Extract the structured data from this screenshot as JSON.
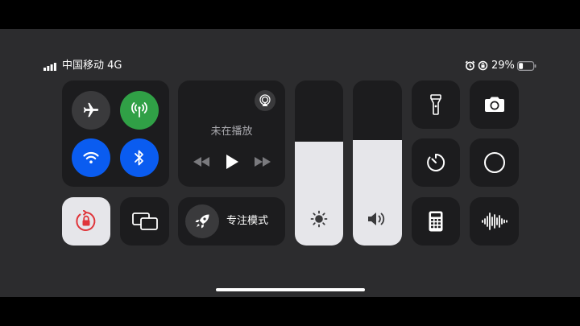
{
  "status_bar": {
    "carrier": "中国移动",
    "network": "4G",
    "battery_percent": "29%",
    "battery_level": 0.29,
    "signal_bars": 4,
    "alarm_icon": "alarm-clock-icon",
    "orientation_lock_icon": "rotation-lock-icon"
  },
  "connectivity": {
    "airplane": {
      "icon": "airplane-icon",
      "on": false
    },
    "cellular": {
      "icon": "antenna-icon",
      "on": true,
      "color": "#30a046"
    },
    "wifi": {
      "icon": "wifi-icon",
      "on": true,
      "color": "#0a5cf0"
    },
    "bluetooth": {
      "icon": "bluetooth-icon",
      "on": true,
      "color": "#0a5cf0"
    }
  },
  "now_playing": {
    "status": "未在播放",
    "airplay_icon": "airplay-icon",
    "controls": [
      "rewind-icon",
      "play-icon",
      "fast-forward-icon"
    ]
  },
  "focus": {
    "label": "专注模式",
    "icon": "rocket-icon"
  },
  "brightness": {
    "level": 0.63,
    "icon": "sun-icon"
  },
  "volume": {
    "level": 0.64,
    "icon": "speaker-icon"
  },
  "shortcuts": [
    {
      "name": "flashlight",
      "icon": "flashlight-icon"
    },
    {
      "name": "camera",
      "icon": "camera-icon"
    },
    {
      "name": "timer",
      "icon": "timer-icon"
    },
    {
      "name": "screen-recording",
      "icon": "record-icon"
    },
    {
      "name": "calculator",
      "icon": "calculator-icon"
    },
    {
      "name": "voice-memos",
      "icon": "waveform-icon"
    }
  ],
  "orientation_lock": {
    "on": true,
    "accent": "#e0353a"
  },
  "screen_mirroring": {
    "icon": "screen-mirroring-icon"
  },
  "colors": {
    "tile": "#1c1c1e",
    "active_white": "#e6e6ea",
    "background": "#2c2c2e"
  }
}
